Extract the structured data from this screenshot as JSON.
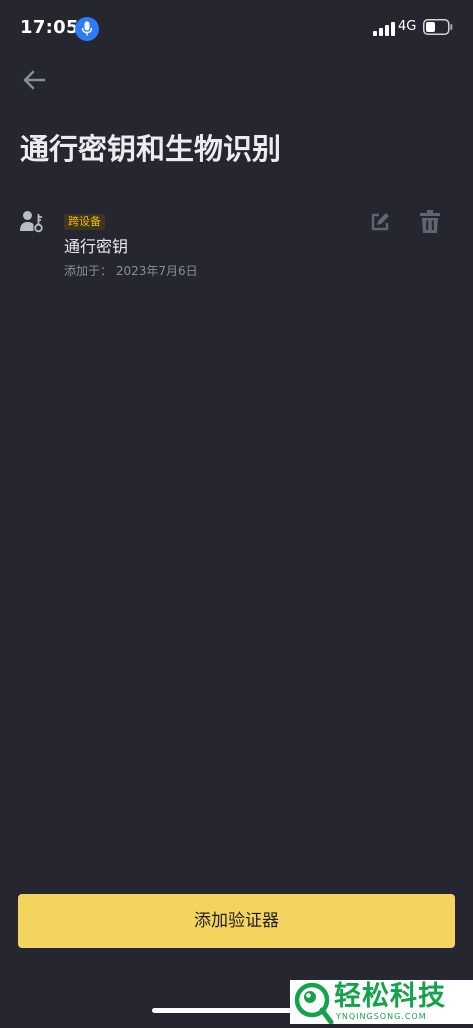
{
  "status_bar": {
    "time": "17:05",
    "network": "4G",
    "icons": [
      "microphone-icon",
      "signal-icon",
      "battery-icon"
    ]
  },
  "header": {
    "back_icon": "arrow-left-icon",
    "title": "通行密钥和生物识别"
  },
  "passkeys": [
    {
      "badge": "跨设备",
      "name": "通行密钥",
      "added": "添加于： 2023年7月6日",
      "icons": [
        "user-key-icon",
        "edit-icon",
        "trash-icon"
      ]
    }
  ],
  "actions": {
    "add_authenticator_label": "添加验证器"
  },
  "watermark": {
    "title": "轻松科技",
    "subtitle": "YNQINGSONG.COM"
  },
  "colors": {
    "background": "#252630",
    "accent_button": "#f4d35e",
    "badge_text": "#f0b90b",
    "badge_bg": "#3d3621",
    "text_primary": "#eaecef",
    "text_secondary": "#848e9c",
    "watermark_green": "#14a24a"
  }
}
